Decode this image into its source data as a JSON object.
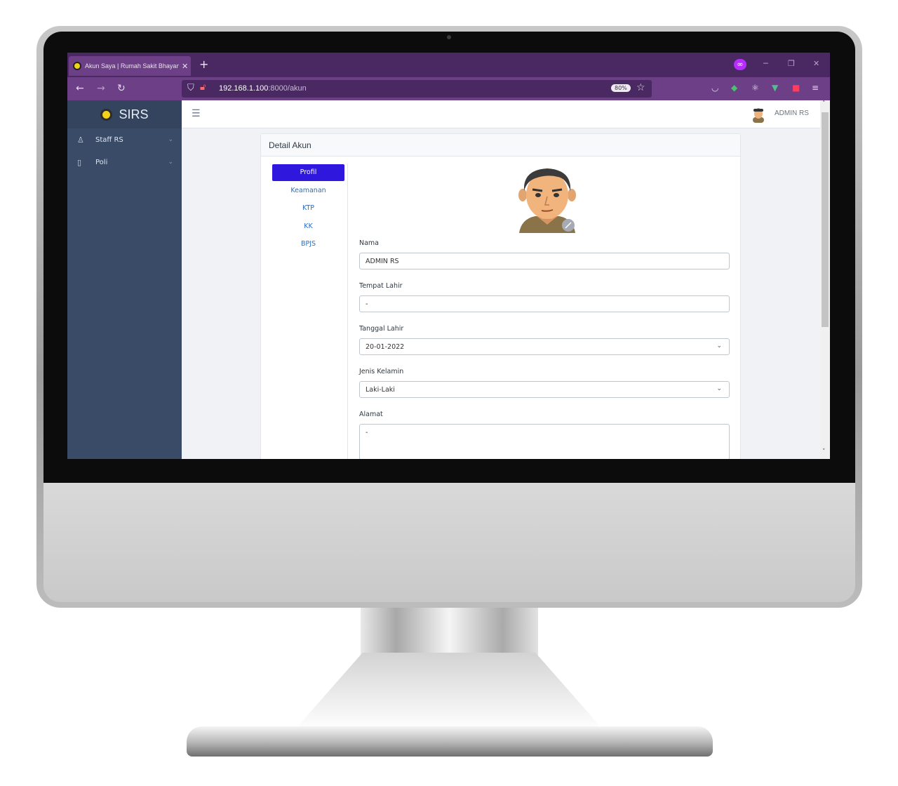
{
  "browser": {
    "tab_title": "Akun Saya | Rumah Sakit Bhayangkara",
    "tab_close": "✕",
    "new_tab": "+",
    "url_host": "192.168.1.100",
    "url_rest": ":8000/akun",
    "zoom": "80%",
    "ext_badge": "∞"
  },
  "sidebar": {
    "brand": "SIRS",
    "items": [
      {
        "label": "Staff RS",
        "icon": "user-icon"
      },
      {
        "label": "Poli",
        "icon": "door-icon"
      }
    ]
  },
  "topbar": {
    "username": "ADMIN RS"
  },
  "card": {
    "title": "Detail Akun",
    "tabs": [
      "Profil",
      "Keamanan",
      "KTP",
      "KK",
      "BPJS"
    ],
    "active_tab": "Profil"
  },
  "form": {
    "nama_label": "Nama",
    "nama_value": "ADMIN RS",
    "tempat_label": "Tempat Lahir",
    "tempat_value": "-",
    "tanggal_label": "Tanggal Lahir",
    "tanggal_value": "20-01-2022",
    "jk_label": "Jenis Kelamin",
    "jk_value": "Laki-Laki",
    "alamat_label": "Alamat",
    "alamat_value": "-"
  },
  "colors": {
    "browser_tabbar": "#4a2862",
    "browser_toolbar": "#6d3f87",
    "sidebar": "#3a4b68",
    "active_pill": "#2f17de",
    "link": "#2f6db5"
  }
}
